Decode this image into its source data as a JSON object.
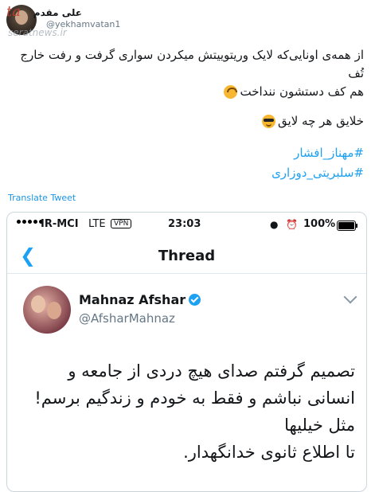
{
  "tweet": {
    "display_name": "علی مقدم",
    "handle": "@yekhamvatan1",
    "watermark_text": "ta",
    "site_watermark": "seratnews.ir",
    "lines": [
      "از همه‌ی اونایی‌که لایک وریتوییتش میکردن سواری گرفت و رفت خارج تُف",
      "هم کف دستشون ننداخت"
    ],
    "line2": "خلایق هر چه لایق",
    "hashtags": [
      "#مهناز_افشار",
      "#سلبریتی_دوزاری"
    ],
    "translate_label": "Translate Tweet"
  },
  "screenshot": {
    "status": {
      "carrier": "IR-MCI",
      "network": "LTE",
      "vpn": "VPN",
      "time": "23:03",
      "battery_pct": "100%"
    },
    "nav_title": "Thread",
    "inner": {
      "name": "Mahnaz Afshar",
      "handle": "@AfsharMahnaz",
      "text_lines": [
        "تصمیم گرفتم صدای هیچ دردی از جامعه و",
        "انسانی نباشم و فقط به خودم و زندگیم برسم!",
        "مثل خیلیها",
        "تا اطلاع ثانوی خدانگهدار."
      ]
    }
  }
}
